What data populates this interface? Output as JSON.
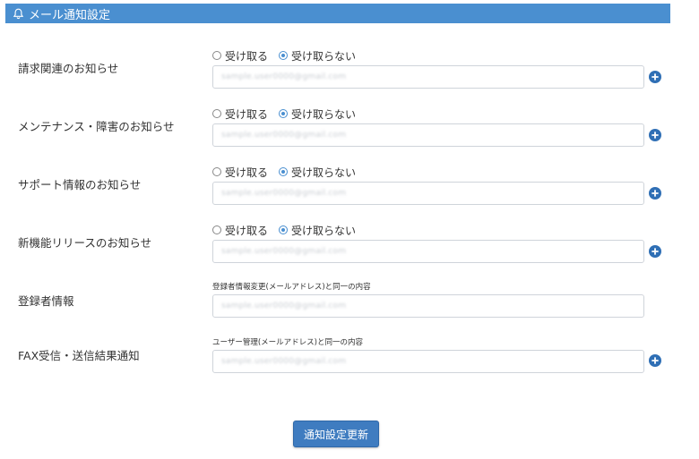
{
  "header": {
    "title": "メール通知設定",
    "icon": "bell-icon",
    "color": "#4a8fd0"
  },
  "radio_labels": {
    "accept": "受け取る",
    "decline": "受け取らない"
  },
  "rows": [
    {
      "label": "請求関連のお知らせ",
      "selected": "decline",
      "email": "sample.user0000@gmail.com",
      "has_add": true
    },
    {
      "label": "メンテナンス・障害のお知らせ",
      "selected": "decline",
      "email": "sample.user0000@gmail.com",
      "has_add": true
    },
    {
      "label": "サポート情報のお知らせ",
      "selected": "decline",
      "email": "sample.user0000@gmail.com",
      "has_add": true
    },
    {
      "label": "新機能リリースのお知らせ",
      "selected": "decline",
      "email": "sample.user0000@gmail.com",
      "has_add": true
    },
    {
      "label": "登録者情報",
      "note": "登録者情報変更(メールアドレス)と同一の内容",
      "email": "sample.user0000@gmail.com",
      "has_add": false
    },
    {
      "label": "FAX受信・送信結果通知",
      "note": "ユーザー管理(メールアドレス)と同一の内容",
      "email": "sample.user0000@gmail.com",
      "has_add": true
    }
  ],
  "submit_label": "通知設定更新"
}
